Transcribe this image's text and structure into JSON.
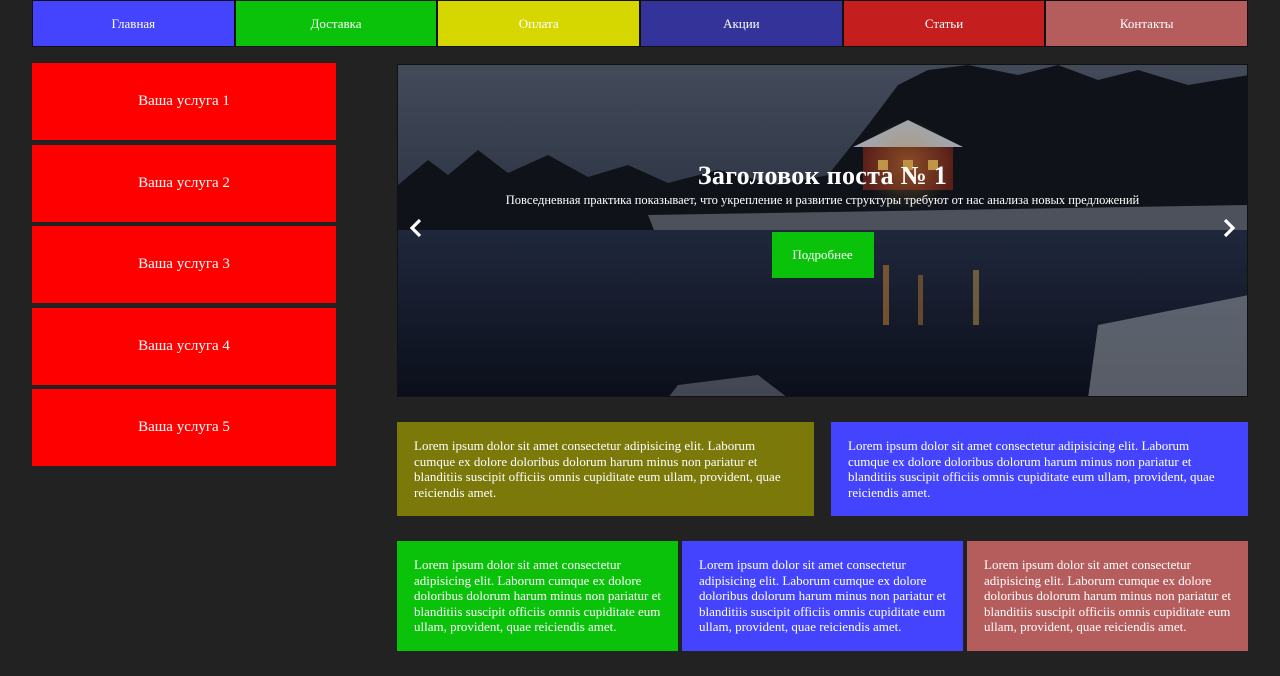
{
  "nav": [
    {
      "label": "Главная",
      "color": "#4444ff"
    },
    {
      "label": "Доставка",
      "color": "#0ac20a"
    },
    {
      "label": "Оплата",
      "color": "#d6d600"
    },
    {
      "label": "Акции",
      "color": "#333399"
    },
    {
      "label": "Статьи",
      "color": "#c41e1e"
    },
    {
      "label": "Контакты",
      "color": "#b55c5c"
    }
  ],
  "services": [
    {
      "label": "Ваша услуга 1"
    },
    {
      "label": "Ваша услуга 2"
    },
    {
      "label": "Ваша услуга 3"
    },
    {
      "label": "Ваша услуга 4"
    },
    {
      "label": "Ваша услуга 5"
    }
  ],
  "service_color": "#ff0000",
  "slider": {
    "title": "Заголовок поста № 1",
    "text": "Повседневная практика показывает, что укрепление и развитие структуры требуют от нас анализа новых предложений",
    "button": "Подробнее",
    "prev_icon": "chevron-left-icon",
    "next_icon": "chevron-right-icon"
  },
  "cards_row1": [
    {
      "text": "Lorem ipsum dolor sit amet consectetur adipisicing elit. Laborum cumque ex dolore doloribus dolorum harum minus non pariatur et blanditiis suscipit officiis omnis cupiditate eum ullam, provident, quae reiciendis amet.",
      "color": "#7a790a"
    },
    {
      "text": "Lorem ipsum dolor sit amet consectetur adipisicing elit. Laborum cumque ex dolore doloribus dolorum harum minus non pariatur et blanditiis suscipit officiis omnis cupiditate eum ullam, provident, quae reiciendis amet.",
      "color": "#4444ff"
    }
  ],
  "cards_row2": [
    {
      "text": "Lorem ipsum dolor sit amet consectetur adipisicing elit. Laborum cumque ex dolore doloribus dolorum harum minus non pariatur et blanditiis suscipit officiis omnis cupiditate eum ullam, provident, quae reiciendis amet.",
      "color": "#0ac20a"
    },
    {
      "text": "Lorem ipsum dolor sit amet consectetur adipisicing elit. Laborum cumque ex dolore doloribus dolorum harum minus non pariatur et blanditiis suscipit officiis omnis cupiditate eum ullam, provident, quae reiciendis amet.",
      "color": "#4444ff"
    },
    {
      "text": "Lorem ipsum dolor sit amet consectetur adipisicing elit. Laborum cumque ex dolore doloribus dolorum harum minus non pariatur et blanditiis suscipit officiis omnis cupiditate eum ullam, provident, quae reiciendis amet.",
      "color": "#b55c5c"
    }
  ]
}
